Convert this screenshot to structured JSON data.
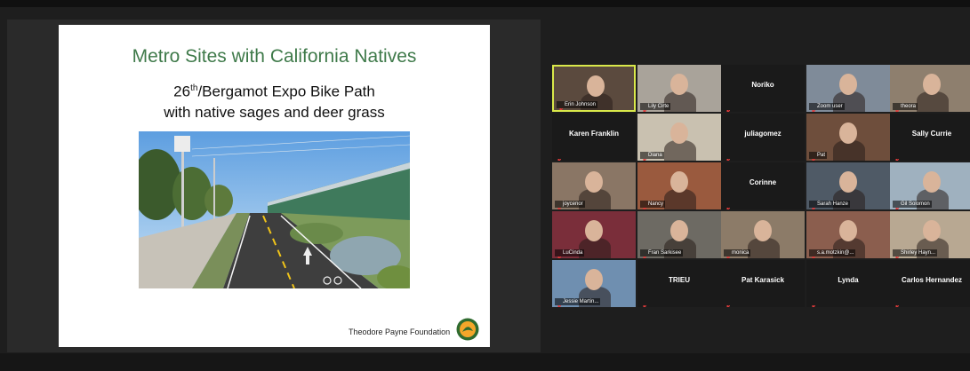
{
  "slide": {
    "title": "Metro Sites with California Natives",
    "subtitle_num": "26",
    "subtitle_sup": "th",
    "subtitle_rest": "/Bergamot Expo Bike Path",
    "subtitle_line2": "with native sages and deer grass",
    "footer": "Theodore Payne Foundation"
  },
  "participants": [
    {
      "id": "erin",
      "label": "Erin Johnson",
      "kind": "video",
      "bg": "#5b4a3e",
      "active": true
    },
    {
      "id": "lily",
      "label": "Lily Cirte",
      "kind": "video",
      "bg": "#a9a39a"
    },
    {
      "id": "noriko",
      "label": "Noriko",
      "kind": "name"
    },
    {
      "id": "zoom",
      "label": "Zoom user",
      "kind": "video",
      "bg": "#7f8b99"
    },
    {
      "id": "theora",
      "label": "theora",
      "kind": "video",
      "bg": "#8e7f6e"
    },
    {
      "id": "karen",
      "label": "Karen Franklin",
      "kind": "name"
    },
    {
      "id": "diana",
      "label": "Diana",
      "kind": "video",
      "bg": "#c9c1b0"
    },
    {
      "id": "julia",
      "label": "juliagomez",
      "kind": "name"
    },
    {
      "id": "pat",
      "label": "Pat",
      "kind": "video",
      "bg": "#6e4e3c"
    },
    {
      "id": "sally",
      "label": "Sally Currie",
      "kind": "name"
    },
    {
      "id": "joyce",
      "label": "joycenor",
      "kind": "video",
      "bg": "#8a7665"
    },
    {
      "id": "nancy",
      "label": "Nancy",
      "kind": "video",
      "bg": "#9a5a3e"
    },
    {
      "id": "corinne",
      "label": "Corinne",
      "kind": "name"
    },
    {
      "id": "sarah",
      "label": "Sarah Hanze",
      "kind": "video",
      "bg": "#4f5a66"
    },
    {
      "id": "gil",
      "label": "Gil Solomon",
      "kind": "video",
      "bg": "#9fb1bf"
    },
    {
      "id": "lu",
      "label": "LuCinda",
      "kind": "video",
      "bg": "#7a2e3a"
    },
    {
      "id": "fran",
      "label": "Fran Sarkisee",
      "kind": "video",
      "bg": "#6d6a63"
    },
    {
      "id": "monica",
      "label": "monica",
      "kind": "video",
      "bg": "#8c7b68"
    },
    {
      "id": "sa",
      "label": "s.a.motzkin@...",
      "kind": "video",
      "bg": "#8b5e4e"
    },
    {
      "id": "shirley",
      "label": "Shirley Hayn...",
      "kind": "video",
      "bg": "#b8a892"
    },
    {
      "id": "jessie",
      "label": "Jessie Martin...",
      "kind": "video",
      "bg": "#6f8fb0"
    },
    {
      "id": "trieu",
      "label": "TRIEU",
      "kind": "name"
    },
    {
      "id": "patk",
      "label": "Pat Karasick",
      "kind": "name"
    },
    {
      "id": "lynda",
      "label": "Lynda",
      "kind": "name"
    },
    {
      "id": "carlos",
      "label": "Carlos Hernandez",
      "kind": "name"
    }
  ],
  "colors": {
    "slide_title": "#3f7a4a",
    "active_border": "#d9e84a",
    "mute_icon": "#e03a3a"
  }
}
